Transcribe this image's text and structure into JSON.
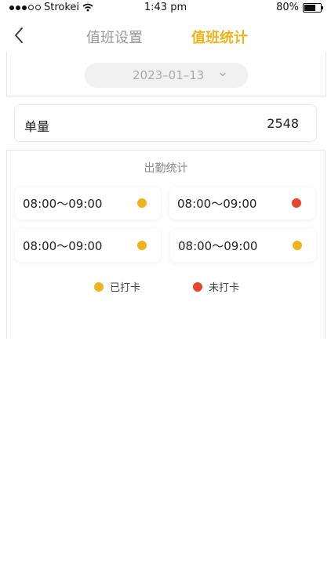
{
  "status_bar": {
    "carrier": "Strokei",
    "time": "1:43 pm",
    "battery": "80%",
    "battery_level": 0.8
  },
  "nav": {
    "tabs": [
      {
        "label": "值班设置",
        "active": false
      },
      {
        "label": "值班统计",
        "active": true
      }
    ]
  },
  "date_picker": {
    "value": "2023–01–13"
  },
  "quantity": {
    "label": "单量",
    "value": "2548"
  },
  "attendance": {
    "title": "出勤统计",
    "slots": [
      {
        "time": "08:00～09:00",
        "status": "checked"
      },
      {
        "time": "08:00～09:00",
        "status": "unchecked"
      },
      {
        "time": "08:00～09:00",
        "status": "checked"
      },
      {
        "time": "08:00～09:00",
        "status": "checked"
      }
    ],
    "legend": {
      "checked": "已打卡",
      "unchecked": "未打卡"
    }
  },
  "colors": {
    "accent": "#f0b31a",
    "checked": "#f0b31a",
    "unchecked": "#e8442c"
  },
  "icons": {
    "back": "chevron-left-icon",
    "dropdown": "chevron-down-icon",
    "wifi": "wifi-icon",
    "battery": "battery-icon"
  }
}
